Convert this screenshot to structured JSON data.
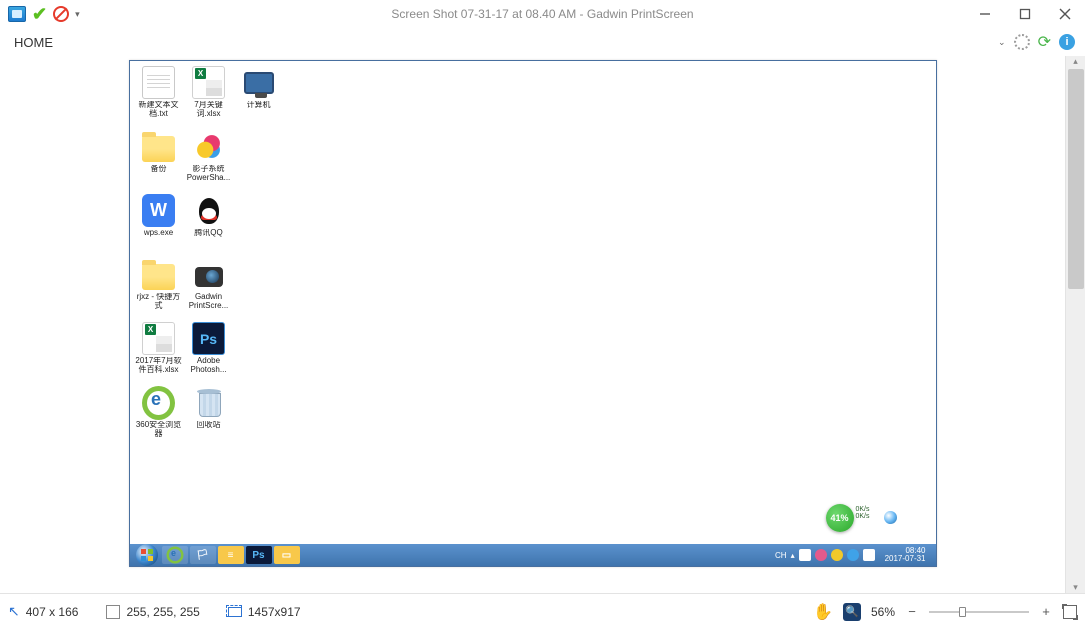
{
  "window": {
    "title": "Screen Shot 07-31-17 at 08.40 AM - Gadwin PrintScreen"
  },
  "menu": {
    "home": "HOME"
  },
  "desktop": {
    "col1": [
      {
        "icon": "file",
        "label": "新建文本文档.txt"
      },
      {
        "icon": "folder",
        "label": "备份"
      },
      {
        "icon": "wps",
        "label": "wps.exe"
      },
      {
        "icon": "folder",
        "label": "rjxz - 快捷方式"
      },
      {
        "icon": "excel",
        "label": "2017年7月软件百科.xlsx"
      },
      {
        "icon": "ie",
        "label": "360安全浏览器"
      }
    ],
    "col2": [
      {
        "icon": "excel",
        "label": "7月关键词.xlsx"
      },
      {
        "icon": "powershade",
        "label": "影子系统PowerSha..."
      },
      {
        "icon": "qq",
        "label": "腾讯QQ"
      },
      {
        "icon": "cam",
        "label": "Gadwin PrintScre..."
      },
      {
        "icon": "ps",
        "label": "Adobe Photosh..."
      },
      {
        "icon": "bin",
        "label": "回收站"
      }
    ],
    "col3": [
      {
        "icon": "monitor",
        "label": "计算机"
      }
    ]
  },
  "badge": {
    "percent": "41%",
    "line1": "0K/s",
    "line2": "0K/s"
  },
  "taskbar": {
    "lang": "CH",
    "clock_time": "08:40",
    "clock_date": "2017-07-31"
  },
  "status": {
    "coords": "407 x 166",
    "rgb": "255, 255, 255",
    "dims": "1457x917",
    "zoom": "56%"
  }
}
